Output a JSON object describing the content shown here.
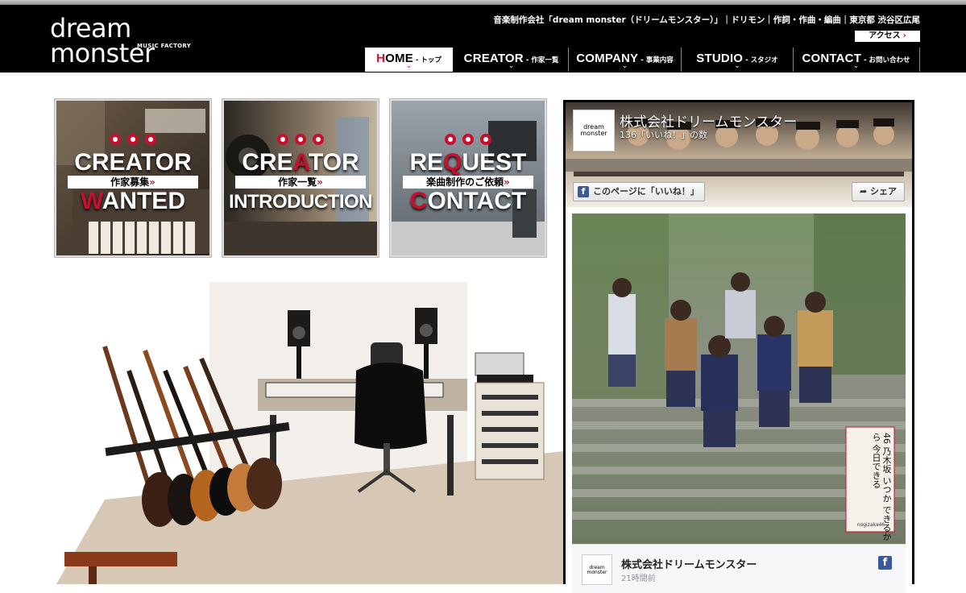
{
  "header": {
    "logo_line1": "dream",
    "logo_line2": "monster",
    "logo_sub": "MUSIC FACTORY",
    "tagline": "音楽制作会社「dream monster（ドリームモンスター）」｜ドリモン｜作詞・作曲・編曲｜東京都 渋谷区広尾",
    "access_label": "アクセス",
    "access_arrow": "›"
  },
  "nav": [
    {
      "first": "H",
      "rest": "OME",
      "sub": "- トップ"
    },
    {
      "first": "C",
      "rest": "REATOR",
      "sub": "- 作家一覧"
    },
    {
      "first": "C",
      "rest": "OMPANY",
      "sub": "- 事業内容"
    },
    {
      "first": "S",
      "rest": "TUDIO",
      "sub": "- スタジオ"
    },
    {
      "first": "C",
      "rest": "ONTACT",
      "sub": "- お問い合わせ"
    }
  ],
  "tiles": [
    {
      "t1_a": "CREATOR",
      "band": "作家募集",
      "band_arrow": "»",
      "t2_red": "W",
      "t2_rest": "ANTED"
    },
    {
      "t1_a": "CRE",
      "t1_red": "A",
      "t1_b": "TOR",
      "band": "作家一覧",
      "band_arrow": "»",
      "t2": "INTRODUCTION"
    },
    {
      "t1_a": "RE",
      "t1_red": "Q",
      "t1_b": "UEST",
      "band": "楽曲制作のご依頼",
      "band_arrow": "»",
      "t2_red": "C",
      "t2_rest": "ONTACT"
    }
  ],
  "facebook": {
    "logo_l1": "dream",
    "logo_l2": "monster",
    "page_name": "株式会社ドリームモンスター",
    "like_count": "136「いいね！」の数",
    "like_icon": "f",
    "like_button": "このページに「いいね！」",
    "share_button": "シェア",
    "photo_caption": [
      "46",
      "乃木坂",
      "いつか",
      "できるから",
      "今日できる"
    ],
    "photo_credit": "nogizaka46",
    "post_name": "株式会社ドリームモンスター",
    "post_time": "21時間前",
    "post_icon": "f"
  }
}
